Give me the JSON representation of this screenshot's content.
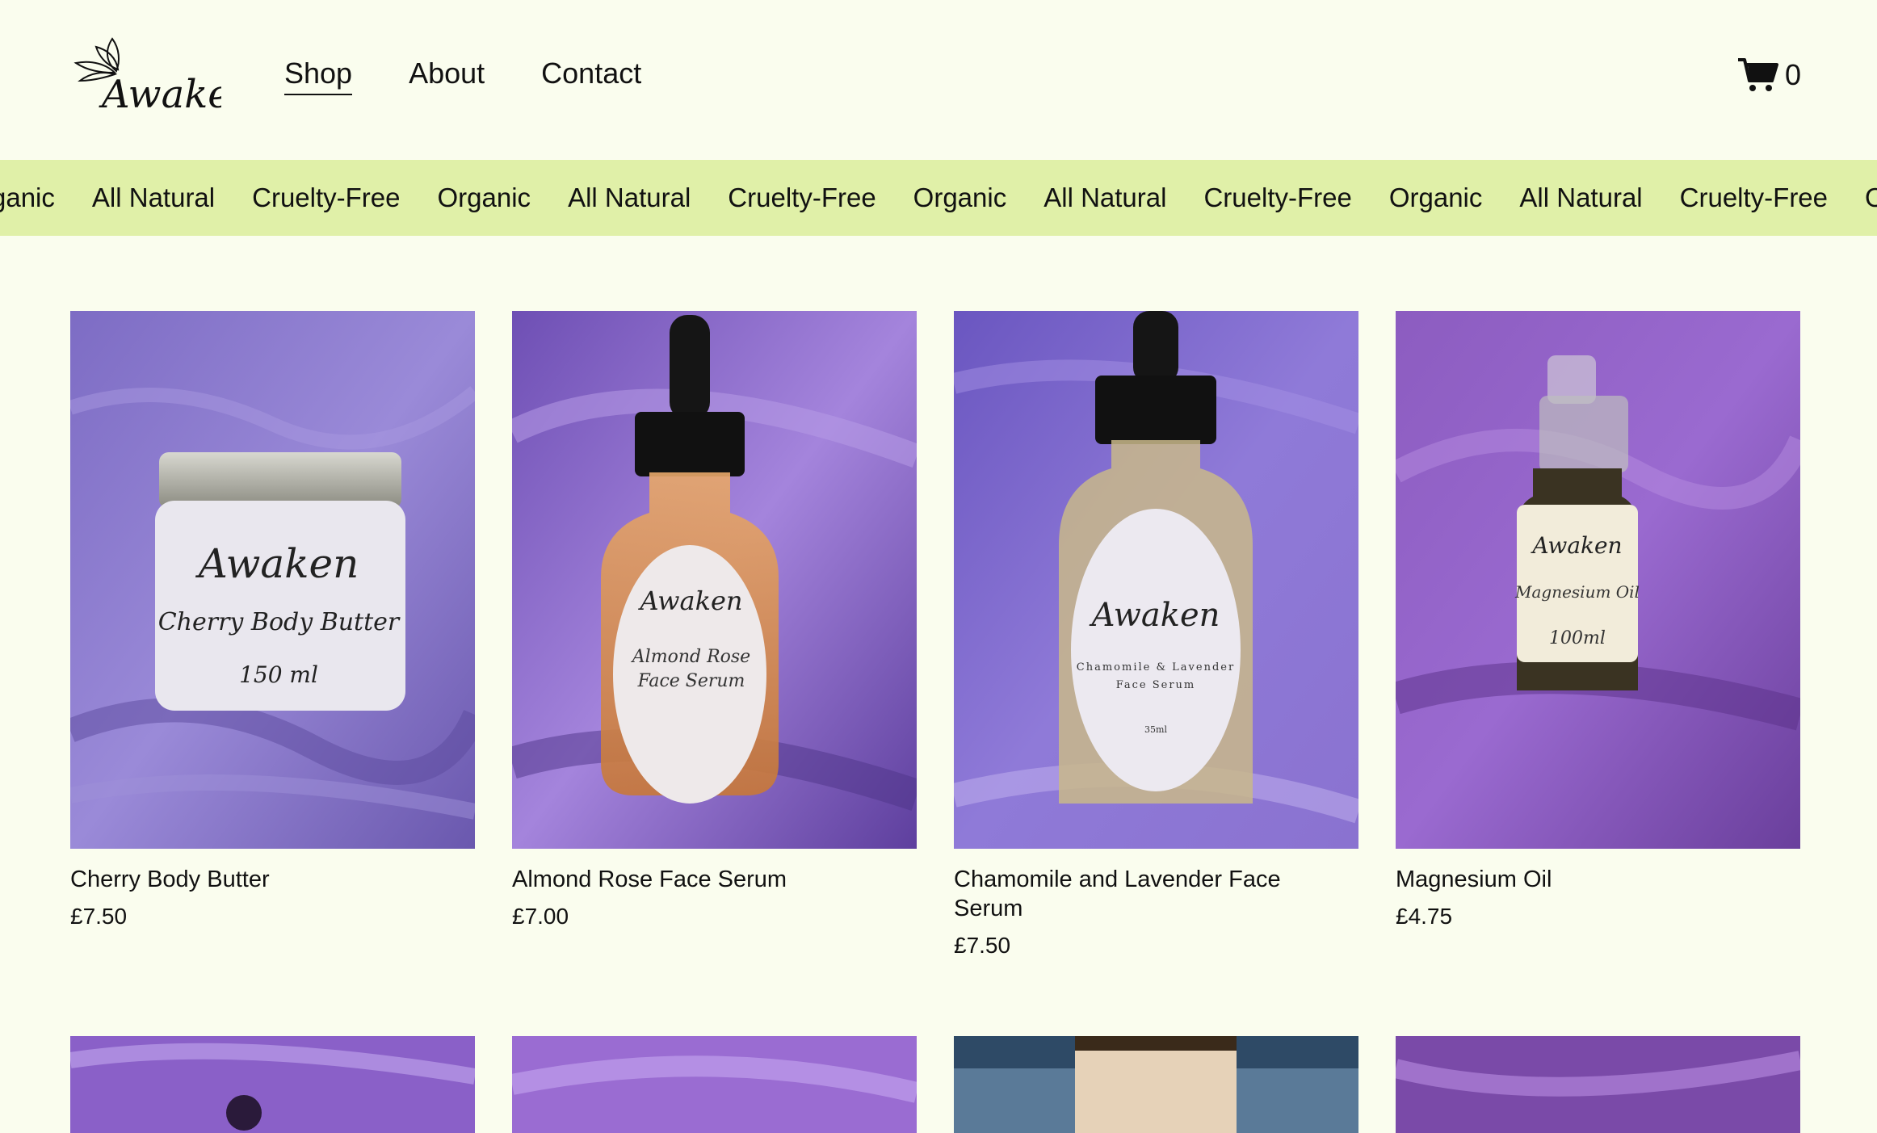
{
  "brand": {
    "logo_text": "Awaken"
  },
  "nav": {
    "items": [
      {
        "label": "Shop",
        "active": true
      },
      {
        "label": "About",
        "active": false
      },
      {
        "label": "Contact",
        "active": false
      }
    ]
  },
  "cart": {
    "count": "0",
    "icon": "cart-icon"
  },
  "banner": {
    "items": [
      "rganic",
      "All Natural",
      "Cruelty-Free",
      "Organic",
      "All Natural",
      "Cruelty-Free",
      "Organic",
      "All Natural",
      "Cruelty-Free",
      "Organic",
      "All Natural",
      "Cruelty-Free",
      "Or"
    ]
  },
  "products": [
    {
      "name": "Cherry Body Butter",
      "price": "£7.50",
      "label_lines": [
        "Awaken",
        "Cherry Body Butter",
        "150 ml"
      ]
    },
    {
      "name": "Almond Rose Face Serum",
      "price": "£7.00",
      "label_lines": [
        "Awaken",
        "Almond Rose",
        "Face Serum"
      ]
    },
    {
      "name": "Chamomile and Lavender Face Serum",
      "price": "£7.50",
      "label_lines": [
        "Awaken",
        "Chamomile & Lavender",
        "Face Serum",
        "35ml"
      ]
    },
    {
      "name": "Magnesium Oil",
      "price": "£4.75",
      "label_lines": [
        "Awaken",
        "Magnesium Oil",
        "100ml"
      ]
    }
  ],
  "colors": {
    "background": "#fafdee",
    "banner": "#e0f0a8",
    "fabric": "#7a5cc2"
  }
}
